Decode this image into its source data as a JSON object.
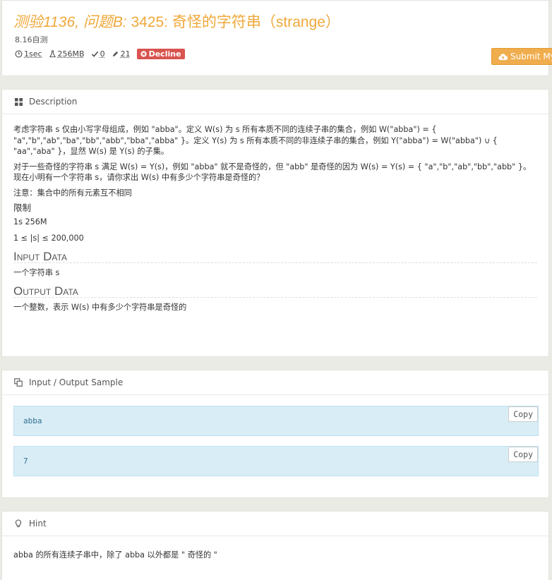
{
  "problem": {
    "title_part1": "测验1136, 问题B:",
    "title_part2": " 3425: 奇怪的字符串（strange）",
    "subtitle": "8.16自测",
    "time": "1sec",
    "memory": "256MB",
    "accepted": "0",
    "submissions": "21",
    "status_badge": "Decline",
    "submit_label": "Submit My"
  },
  "description": {
    "header": "Description",
    "p1": "考虑字符串 s 仅由小写字母组成，例如 \"abba\"。定义 W(s) 为 s 所有本质不同的连续子串的集合，例如 W(\"abba\") = { \"a\",\"b\",\"ab\",\"ba\",\"bb\",\"abb\",\"bba\",\"abba\" }。定义 Y(s) 为 s 所有本质不同的非连续子串的集合，例如 Y(\"abba\") = W(\"abba\") ∪ { \"aa\",\"aba\" }，显然 W(s) 是 Y(s) 的子集。",
    "p2": "对于一些奇怪的字符串 s 满足 W(s) = Y(s)，例如 \"abba\" 就不是奇怪的，但 \"abb\" 是奇怪的因为 W(s) = Y(s) = { \"a\",\"b\",\"ab\",\"bb\",\"abb\" }。现在小明有一个字符串 s，请你求出 W(s) 中有多少个字符串是奇怪的？",
    "p3": "注意：集合中的所有元素互不相同",
    "limit_heading": "限制",
    "limit_1": "1s 256M",
    "limit_2": "1 ≤ |s| ≤ 200,000",
    "input_heading": "Input Data",
    "input_text": "一个字符串 s",
    "output_heading": "Output Data",
    "output_text": "一个整数，表示 W(s) 中有多少个字符串是奇怪的"
  },
  "sample": {
    "header": "Input / Output Sample",
    "input": "abba",
    "output": "7",
    "copy_label": "Copy"
  },
  "hint": {
    "header": "Hint",
    "text": "abba 的所有连续子串中，除了 abba 以外都是 \" 奇怪的 \""
  },
  "colors": {
    "title": "#f0a83a",
    "submit": "#f0ad4e",
    "badge": "#d9534f",
    "sample_bg": "#d9edf7"
  }
}
